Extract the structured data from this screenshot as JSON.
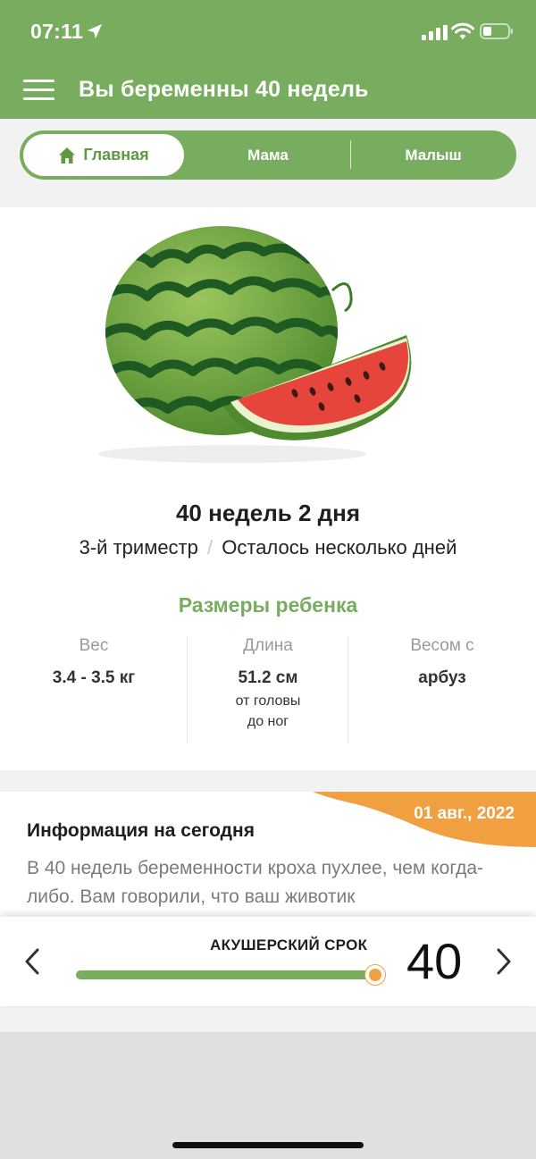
{
  "status_bar": {
    "time": "07:11"
  },
  "header": {
    "title": "Вы беременны 40 недель"
  },
  "tabs": [
    {
      "label": "Главная",
      "active": true,
      "icon": "home-icon"
    },
    {
      "label": "Мама",
      "active": false
    },
    {
      "label": "Малыш",
      "active": false
    }
  ],
  "overview": {
    "fruit_icon": "watermelon-image",
    "week_title": "40 недель 2 дня",
    "trimester": "3-й триместр",
    "separator": "/",
    "remaining": "Осталось несколько дней",
    "sizes_title": "Размеры ребенка",
    "weight": {
      "label": "Вес",
      "value": "3.4 - 3.5 кг"
    },
    "length": {
      "label": "Длина",
      "value": "51.2 см",
      "note_line1": "от головы",
      "note_line2": "до ног"
    },
    "size_as": {
      "label": "Весом с",
      "value": "арбуз"
    }
  },
  "info": {
    "date": "01 авг., 2022",
    "title": "Информация на сегодня",
    "text": "В 40 недель беременности кроха пухлее, чем когда-либо. Вам говорили, что ваш животик"
  },
  "week_slider": {
    "label": "АКУШЕРСКИЙ СРОК",
    "week": "40",
    "fill_fraction": 1.0
  },
  "colors": {
    "brand_green": "#78ad5f",
    "accent_orange": "#f0a040"
  }
}
